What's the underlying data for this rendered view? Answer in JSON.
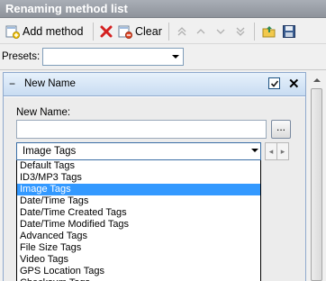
{
  "window": {
    "title": "Renaming method list"
  },
  "toolbar": {
    "add_method_label": "Add method",
    "clear_label": "Clear"
  },
  "presets": {
    "label": "Presets:",
    "value": ""
  },
  "panel": {
    "title": "New Name",
    "collapse_symbol": "−",
    "enabled": true,
    "close_symbol": "✕",
    "new_name_label": "New Name:",
    "new_name_value": "",
    "browse_label": "...",
    "tag_type_selected": "Image Tags",
    "tag_types": [
      {
        "label": "Default Tags",
        "selected": false
      },
      {
        "label": "ID3/MP3 Tags",
        "selected": false
      },
      {
        "label": "Image Tags",
        "selected": true
      },
      {
        "label": "Date/Time Tags",
        "selected": false
      },
      {
        "label": "Date/Time Created Tags",
        "selected": false
      },
      {
        "label": "Date/Time Modified Tags",
        "selected": false
      },
      {
        "label": "Advanced Tags",
        "selected": false
      },
      {
        "label": "File Size Tags",
        "selected": false
      },
      {
        "label": "Video Tags",
        "selected": false
      },
      {
        "label": "GPS Location Tags",
        "selected": false
      },
      {
        "label": "Checksum Tags",
        "selected": false
      }
    ]
  },
  "colors": {
    "selection": "#3399ff",
    "titlebar": "#9aa0a8",
    "panel_header": "#d6e5f5"
  }
}
